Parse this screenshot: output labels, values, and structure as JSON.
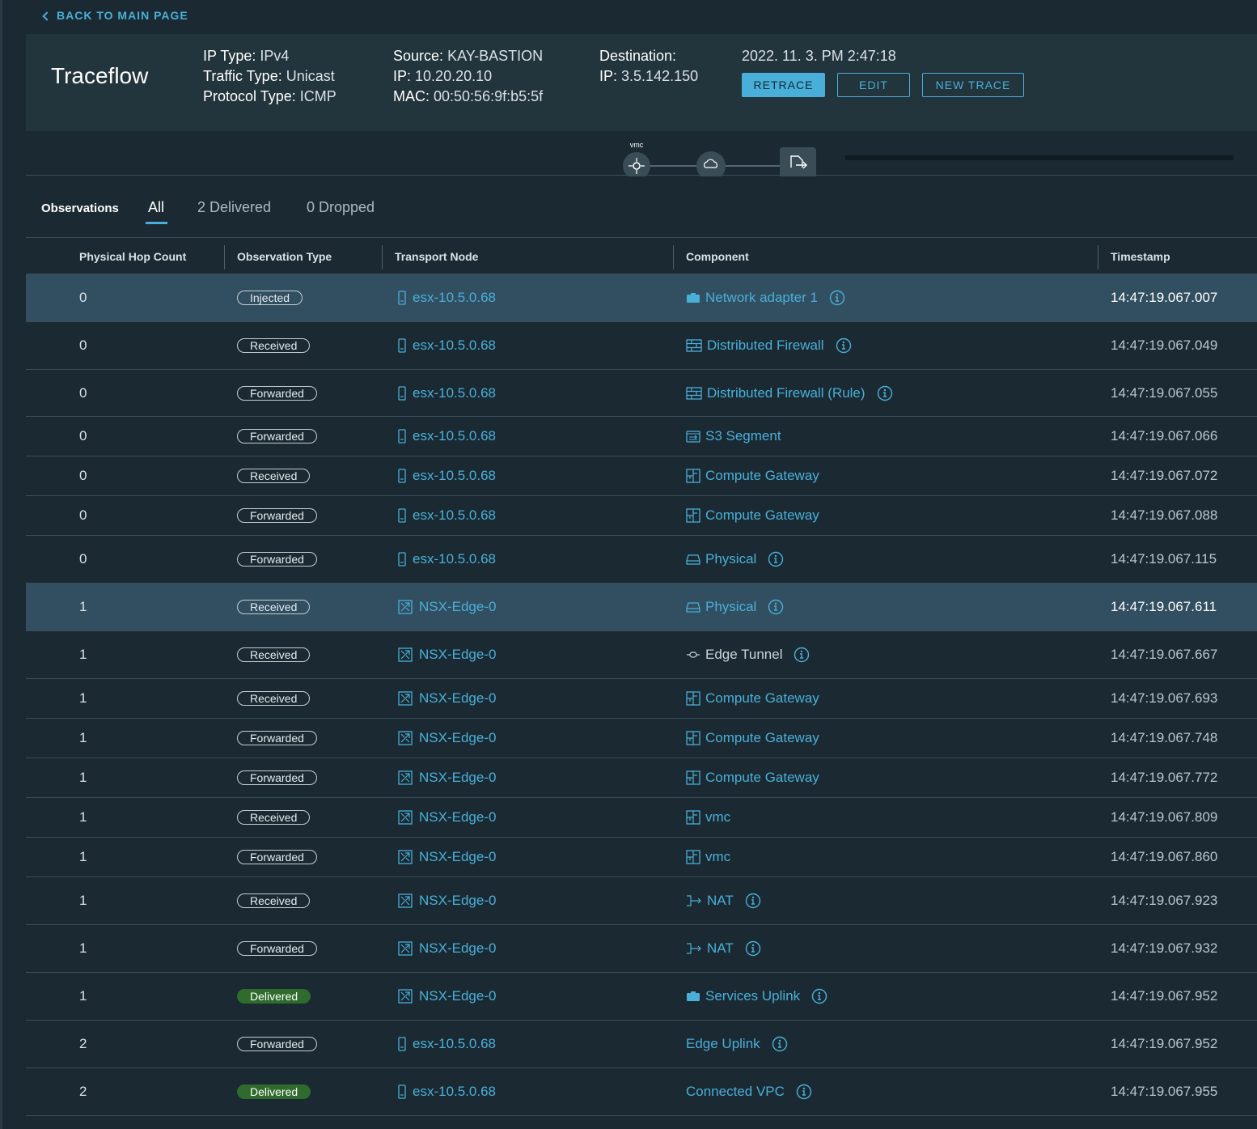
{
  "nav": {
    "back_label": "BACK TO MAIN PAGE"
  },
  "header": {
    "title": "Traceflow",
    "ip_type_label": "IP Type:",
    "ip_type": "IPv4",
    "traffic_type_label": "Traffic Type:",
    "traffic_type": "Unicast",
    "protocol_type_label": "Protocol Type:",
    "protocol_type": "ICMP",
    "source_label": "Source:",
    "source": "KAY-BASTION",
    "source_ip_label": "IP:",
    "source_ip": "10.20.20.10",
    "source_mac_label": "MAC:",
    "source_mac": "00:50:56:9f:b5:5f",
    "destination_label": "Destination:",
    "dest_ip_label": "IP:",
    "dest_ip": "3.5.142.150",
    "timestamp": "2022. 11. 3. PM 2:47:18",
    "buttons": {
      "retrace": "RETRACE",
      "edit": "EDIT",
      "new_trace": "NEW TRACE"
    }
  },
  "topology": {
    "node_label": "vmc"
  },
  "tabs": {
    "observations": "Observations",
    "all": "All",
    "delivered": "2 Delivered",
    "dropped": "0 Dropped"
  },
  "table": {
    "columns": [
      "Physical Hop Count",
      "Observation Type",
      "Transport Node",
      "Component",
      "Timestamp"
    ],
    "rows": [
      {
        "hop": "0",
        "type": "Injected",
        "node": "esx-10.5.0.68",
        "component": "Network adapter 1",
        "ts": "14:47:19.067.007"
      },
      {
        "hop": "0",
        "type": "Received",
        "node": "esx-10.5.0.68",
        "component": "Distributed Firewall",
        "ts": "14:47:19.067.049"
      },
      {
        "hop": "0",
        "type": "Forwarded",
        "node": "esx-10.5.0.68",
        "component": "Distributed Firewall (Rule)",
        "ts": "14:47:19.067.055"
      },
      {
        "hop": "0",
        "type": "Forwarded",
        "node": "esx-10.5.0.68",
        "component": "S3 Segment",
        "ts": "14:47:19.067.066"
      },
      {
        "hop": "0",
        "type": "Received",
        "node": "esx-10.5.0.68",
        "component": "Compute Gateway",
        "ts": "14:47:19.067.072"
      },
      {
        "hop": "0",
        "type": "Forwarded",
        "node": "esx-10.5.0.68",
        "component": "Compute Gateway",
        "ts": "14:47:19.067.088"
      },
      {
        "hop": "0",
        "type": "Forwarded",
        "node": "esx-10.5.0.68",
        "component": "Physical",
        "ts": "14:47:19.067.115"
      },
      {
        "hop": "1",
        "type": "Received",
        "node": "NSX-Edge-0",
        "component": "Physical",
        "ts": "14:47:19.067.611"
      },
      {
        "hop": "1",
        "type": "Received",
        "node": "NSX-Edge-0",
        "component": "Edge Tunnel",
        "ts": "14:47:19.067.667"
      },
      {
        "hop": "1",
        "type": "Received",
        "node": "NSX-Edge-0",
        "component": "Compute Gateway",
        "ts": "14:47:19.067.693"
      },
      {
        "hop": "1",
        "type": "Forwarded",
        "node": "NSX-Edge-0",
        "component": "Compute Gateway",
        "ts": "14:47:19.067.748"
      },
      {
        "hop": "1",
        "type": "Forwarded",
        "node": "NSX-Edge-0",
        "component": "Compute Gateway",
        "ts": "14:47:19.067.772"
      },
      {
        "hop": "1",
        "type": "Received",
        "node": "NSX-Edge-0",
        "component": "vmc",
        "ts": "14:47:19.067.809"
      },
      {
        "hop": "1",
        "type": "Forwarded",
        "node": "NSX-Edge-0",
        "component": "vmc",
        "ts": "14:47:19.067.860"
      },
      {
        "hop": "1",
        "type": "Received",
        "node": "NSX-Edge-0",
        "component": "NAT",
        "ts": "14:47:19.067.923"
      },
      {
        "hop": "1",
        "type": "Forwarded",
        "node": "NSX-Edge-0",
        "component": "NAT",
        "ts": "14:47:19.067.932"
      },
      {
        "hop": "1",
        "type": "Delivered",
        "node": "NSX-Edge-0",
        "component": "Services Uplink",
        "ts": "14:47:19.067.952"
      },
      {
        "hop": "2",
        "type": "Forwarded",
        "node": "esx-10.5.0.68",
        "component": "Edge Uplink",
        "ts": "14:47:19.067.952"
      },
      {
        "hop": "2",
        "type": "Delivered",
        "node": "esx-10.5.0.68",
        "component": "Connected VPC",
        "ts": "14:47:19.067.955"
      }
    ]
  },
  "colors": {
    "accent": "#49afd9",
    "background": "#1b2a32",
    "header_bg": "#22343c",
    "selected_row": "#324f61",
    "delivered_badge": "#2e6b2c"
  }
}
